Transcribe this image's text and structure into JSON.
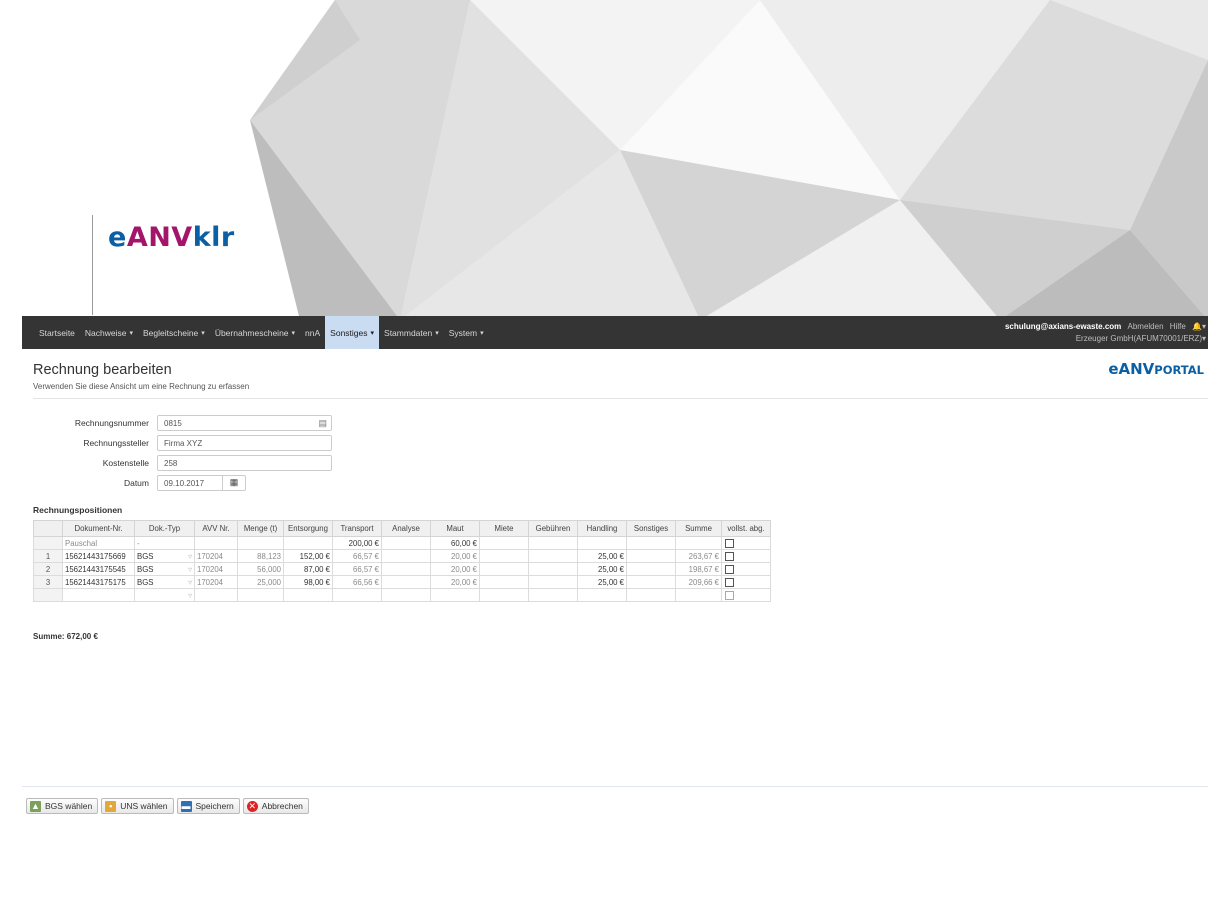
{
  "brand": {
    "part1": "e",
    "part2": "ANV",
    "part3": "klr"
  },
  "navbar": {
    "items": [
      {
        "label": "Startseite",
        "caret": ""
      },
      {
        "label": "Nachweise",
        "caret": "▾"
      },
      {
        "label": "Begleitscheine",
        "caret": "▾"
      },
      {
        "label": "Übernahmescheine",
        "caret": "▾"
      },
      {
        "label": "nnA",
        "caret": ""
      },
      {
        "label": "Sonstiges",
        "caret": "▾"
      },
      {
        "label": "Stammdaten",
        "caret": "▾"
      },
      {
        "label": "System",
        "caret": "▾"
      }
    ],
    "active_index": 5,
    "user": "schulung@axians-ewaste.com",
    "logout": "Abmelden",
    "help": "Hilfe",
    "bell": "🔔▾",
    "company": "Erzeuger GmbH(AFUM70001/ERZ)▾"
  },
  "page": {
    "title": "Rechnung bearbeiten",
    "subtitle": "Verwenden Sie diese Ansicht um eine Rechnung zu erfassen",
    "portal_logo_main": "eANV",
    "portal_logo_small": "PORTAL"
  },
  "form": {
    "rechnungsnummer_label": "Rechnungsnummer",
    "rechnungsnummer_value": "0815",
    "rechnungssteller_label": "Rechnungssteller",
    "rechnungssteller_value": "Firma XYZ",
    "kostenstelle_label": "Kostenstelle",
    "kostenstelle_value": "258",
    "datum_label": "Datum",
    "datum_value": "09.10.2017",
    "calendar_icon": "▦",
    "list_icon": "▤"
  },
  "positions": {
    "title": "Rechnungspositionen",
    "columns": [
      "",
      "Dokument-Nr.",
      "Dok.-Typ",
      "AVV Nr.",
      "Menge (t)",
      "Entsorgung",
      "Transport",
      "Analyse",
      "Maut",
      "Miete",
      "Gebühren",
      "Handling",
      "Sonstiges",
      "Summe",
      "vollst. abg."
    ],
    "rows": [
      {
        "rn": "",
        "doc": "Pauschal",
        "typ": "-",
        "avv": "",
        "menge": "",
        "entsorgung": "",
        "transport": "200,00 €",
        "analyse": "",
        "maut": "60,00 €",
        "miete": "",
        "gebuehren": "",
        "handling": "",
        "sonstiges": "",
        "summe": ""
      },
      {
        "rn": "1",
        "doc": "15621443175669",
        "typ": "BGS",
        "avv": "170204",
        "menge": "88,123",
        "entsorgung": "152,00 €",
        "transport": "66,57 €",
        "analyse": "",
        "maut": "20,00 €",
        "miete": "",
        "gebuehren": "",
        "handling": "25,00 €",
        "sonstiges": "",
        "summe": "263,67 €"
      },
      {
        "rn": "2",
        "doc": "15621443175545",
        "typ": "BGS",
        "avv": "170204",
        "menge": "56,000",
        "entsorgung": "87,00 €",
        "transport": "66,57 €",
        "analyse": "",
        "maut": "20,00 €",
        "miete": "",
        "gebuehren": "",
        "handling": "25,00 €",
        "sonstiges": "",
        "summe": "198,67 €"
      },
      {
        "rn": "3",
        "doc": "15621443175175",
        "typ": "BGS",
        "avv": "170204",
        "menge": "25,000",
        "entsorgung": "98,00 €",
        "transport": "66,56 €",
        "analyse": "",
        "maut": "20,00 €",
        "miete": "",
        "gebuehren": "",
        "handling": "25,00 €",
        "sonstiges": "",
        "summe": "209,66 €"
      },
      {
        "rn": "",
        "doc": "",
        "typ": "",
        "avv": "",
        "menge": "",
        "entsorgung": "",
        "transport": "",
        "analyse": "",
        "maut": "",
        "miete": "",
        "gebuehren": "",
        "handling": "",
        "sonstiges": "",
        "summe": ""
      }
    ],
    "select_glyph": "▿"
  },
  "summary": "Summe: 672,00 €",
  "buttons": {
    "bgs": "BGS wählen",
    "uns": "UNS wählen",
    "save": "Speichern",
    "cancel": "Abbrechen"
  },
  "colors": {
    "nav_bg": "#343434",
    "active_tab": "#c9dcf2",
    "brand_blue": "#0b5fa5",
    "brand_magenta": "#a3146b"
  }
}
